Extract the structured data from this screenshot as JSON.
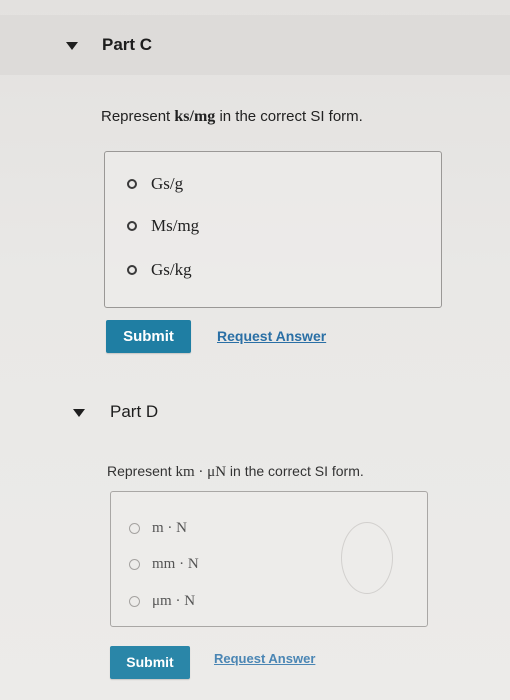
{
  "part_c": {
    "title": "Part C",
    "question_prefix": "Represent ",
    "question_expr": "ks/mg",
    "question_suffix": " in the correct SI form.",
    "options": [
      "Gs/g",
      "Ms/mg",
      "Gs/kg"
    ],
    "submit_label": "Submit",
    "request_label": "Request Answer"
  },
  "part_d": {
    "title": "Part D",
    "question_prefix": "Represent ",
    "question_expr": "km · μN",
    "question_suffix": " in the correct SI form.",
    "options": [
      "m · N",
      "mm · N",
      "μm · N"
    ],
    "submit_label": "Submit",
    "request_label": "Request Answer"
  },
  "colors": {
    "submit_bg": "#1f7ea3",
    "link": "#2a6fa5",
    "page_bg": "#e9e7e4"
  },
  "icons": {
    "collapse": "caret-down-icon",
    "option": "radio-icon"
  }
}
